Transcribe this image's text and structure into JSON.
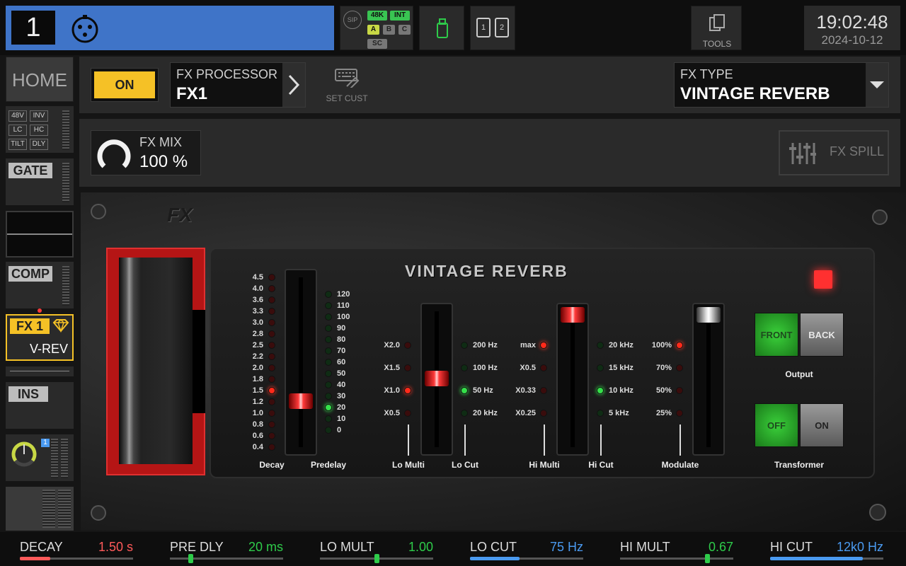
{
  "top": {
    "channel_number": "1",
    "sip_label": "SIP",
    "rate_tag": "48K",
    "clock_tag": "INT",
    "abc": [
      "A",
      "B",
      "C"
    ],
    "sc_tag": "SC",
    "sd_labels": [
      "1",
      "2"
    ],
    "tools_label": "TOOLS",
    "time": "19:02:48",
    "date": "2024-10-12"
  },
  "rail": {
    "home_label": "HOME",
    "filter_tags": [
      "48V",
      "INV",
      "LC",
      "HC",
      "TILT",
      "DLY"
    ],
    "gate_label": "GATE",
    "comp_label": "COMP",
    "fx_label": "FX 1",
    "fx_value": "V-REV",
    "ins_label": "INS",
    "meter_badge": "1"
  },
  "header": {
    "on_label": "ON",
    "fx_processor_label": "FX PROCESSOR",
    "fx_processor_value": "FX1",
    "set_cust_label": "SET CUST",
    "fx_type_label": "FX TYPE",
    "fx_type_value": "VINTAGE REVERB",
    "fx_mix_label": "FX MIX",
    "fx_mix_value": "100 %",
    "fx_spill_label": "FX SPILL"
  },
  "device": {
    "logo": "FX",
    "title": "VINTAGE REVERB",
    "decay_scale": [
      "4.5",
      "4.0",
      "3.6",
      "3.3",
      "3.0",
      "2.8",
      "2.5",
      "2.2",
      "2.0",
      "1.8",
      "1.5",
      "1.2",
      "1.0",
      "0.8",
      "0.6",
      "0.4"
    ],
    "predelay_scale": [
      "120",
      "110",
      "100",
      "90",
      "80",
      "70",
      "60",
      "50",
      "40",
      "30",
      "20",
      "10",
      "0"
    ],
    "lomulti_scale": [
      "X2.0",
      "X1.5",
      "X1.0",
      "X0.5"
    ],
    "locut_scale": [
      "200 Hz",
      "100 Hz",
      "50 Hz",
      "20 kHz"
    ],
    "himulti_scale": [
      "max",
      "X0.5",
      "X0.33",
      "X0.25"
    ],
    "hicut_scale": [
      "20 kHz",
      "15 kHz",
      "10 kHz",
      "5 kHz"
    ],
    "modulate_scale": [
      "100%",
      "70%",
      "50%",
      "25%"
    ],
    "labels": {
      "decay": "Decay",
      "predelay": "Predelay",
      "lo_multi": "Lo Multi",
      "lo_cut": "Lo Cut",
      "hi_multi": "Hi Multi",
      "hi_cut": "Hi Cut",
      "modulate": "Modulate",
      "output": "Output",
      "transformer": "Transformer"
    },
    "output_front": "FRONT",
    "output_back": "BACK",
    "transformer_off": "OFF",
    "transformer_on": "ON",
    "active": {
      "decay": "1.5",
      "predelay": "20",
      "lo_multi": "X1.0",
      "lo_cut": "50 Hz",
      "hi_multi": "max",
      "hi_cut": "10 kHz",
      "modulate": "100%"
    }
  },
  "bottom": [
    {
      "name": "DECAY",
      "value": "1.50 s",
      "color": "#ff5a5a",
      "level": 0.27
    },
    {
      "name": "PRE DLY",
      "value": "20 ms",
      "color": "#2ecb4a",
      "level": 0.18
    },
    {
      "name": "LO MULT",
      "value": "1.00",
      "color": "#2ecb4a",
      "level": 0.5
    },
    {
      "name": "LO CUT",
      "value": "75 Hz",
      "color": "#4a9af0",
      "level": 0.44
    },
    {
      "name": "HI MULT",
      "value": "0.67",
      "color": "#2ecb4a",
      "level": 0.77
    },
    {
      "name": "HI CUT",
      "value": "12k0 Hz",
      "color": "#4a9af0",
      "level": 0.82
    }
  ],
  "colors": {
    "accent_blue": "#3f74c8",
    "on_yellow": "#f5c126",
    "fx_yellow": "#f5c126"
  }
}
